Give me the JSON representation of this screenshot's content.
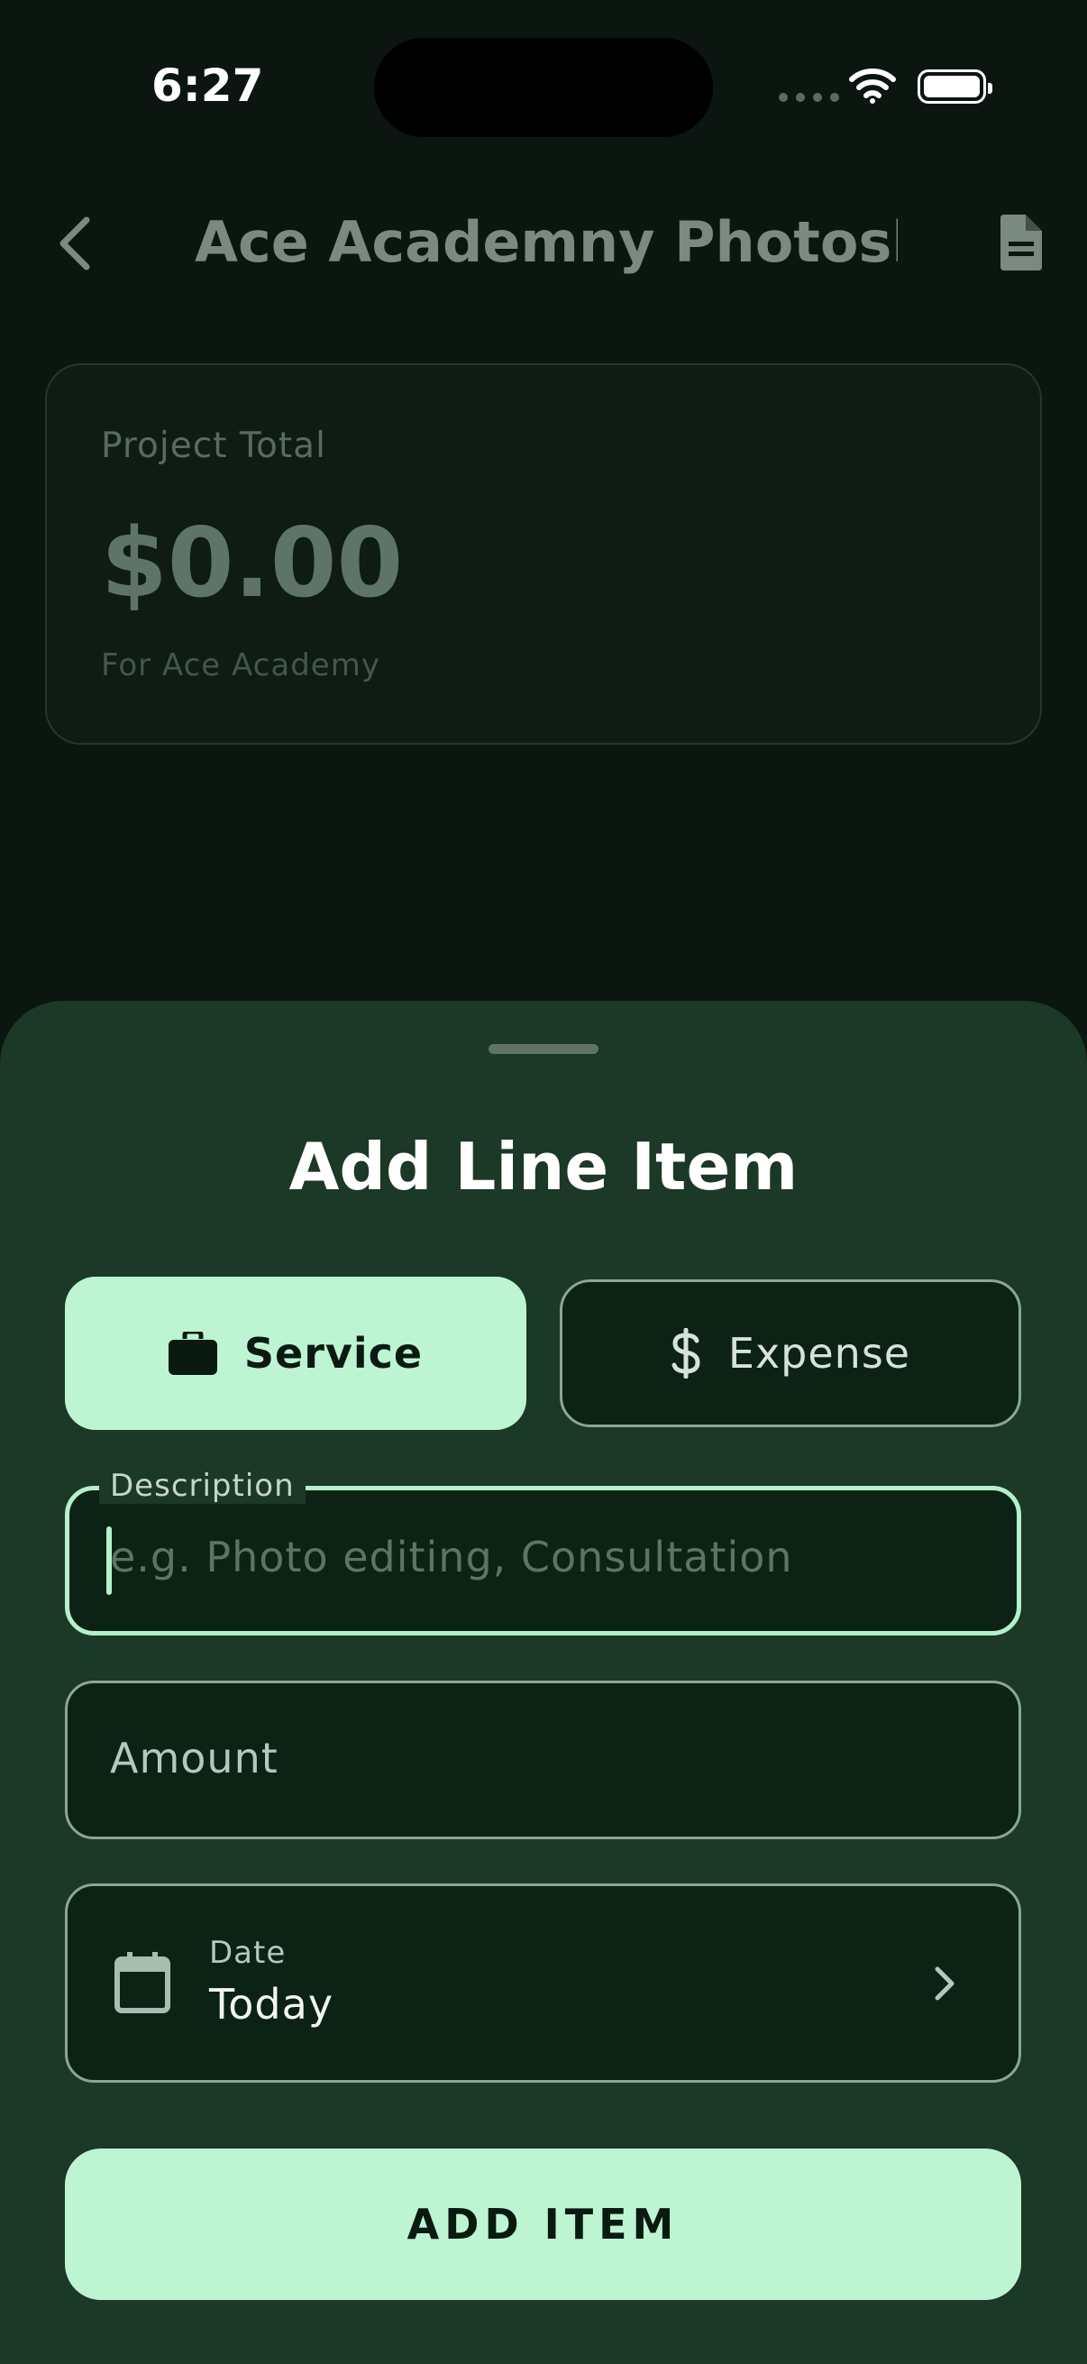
{
  "status_bar": {
    "time": "6:27"
  },
  "nav": {
    "title": "Ace Academny Photosh...",
    "back_icon": "chevron-left-icon",
    "document_icon": "document-icon"
  },
  "project_card": {
    "label": "Project Total",
    "amount": "$0.00",
    "client_line": "For Ace Academy"
  },
  "sheet": {
    "title": "Add Line Item",
    "types": [
      {
        "label": "Service",
        "icon": "briefcase-icon",
        "selected": true
      },
      {
        "label": "Expense",
        "icon": "dollar-icon",
        "selected": false
      }
    ],
    "description": {
      "label": "Description",
      "placeholder": "e.g. Photo editing, Consultation",
      "value": ""
    },
    "amount": {
      "placeholder": "Amount",
      "value": ""
    },
    "date": {
      "label": "Date",
      "value": "Today"
    },
    "submit_label": "ADD ITEM"
  },
  "colors": {
    "background": "#0a160f",
    "sheet": "#1c3826",
    "accent": "#bdf5d2",
    "field": "#0c2214"
  }
}
